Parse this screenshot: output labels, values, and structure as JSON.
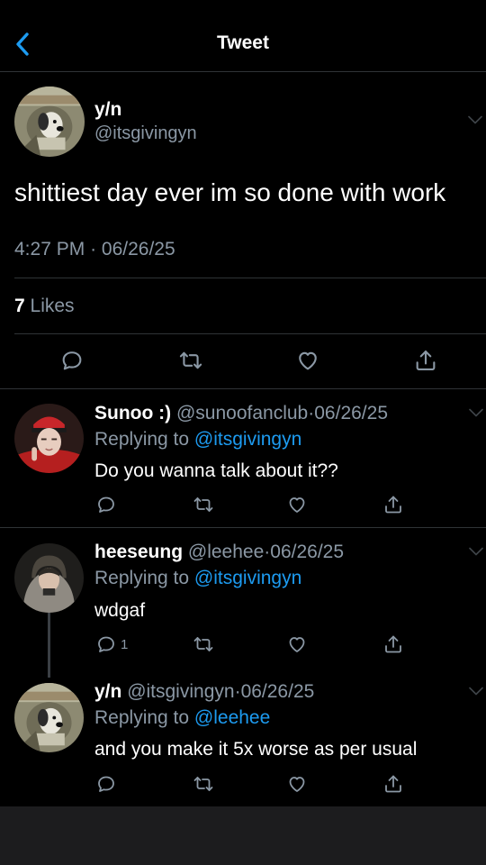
{
  "header": {
    "title": "Tweet"
  },
  "tweet": {
    "name": "y/n",
    "handle": "@itsgivingyn",
    "text": "shittiest day ever im so done with work",
    "time": "4:27 PM",
    "date": "06/26/25",
    "likes_count": "7",
    "likes_label": "Likes"
  },
  "replies": [
    {
      "name": "Sunoo :)",
      "handle": "@sunoofanclub",
      "date": "06/26/25",
      "replying_label": "Replying to",
      "replying_to": "@itsgivingyn",
      "text": "Do you wanna talk about it??",
      "reply_count": ""
    },
    {
      "name": "heeseung",
      "handle": "@leehee",
      "date": "06/26/25",
      "replying_label": "Replying to",
      "replying_to": "@itsgivingyn",
      "text": "wdgaf",
      "reply_count": "1"
    },
    {
      "name": "y/n",
      "handle": "@itsgivingyn",
      "date": "06/26/25",
      "replying_label": "Replying to",
      "replying_to": "@leehee",
      "text": "and you make it 5x worse as per usual",
      "reply_count": ""
    }
  ],
  "separator": "·",
  "icons": [
    "back-chevron-icon",
    "more-chevron-icon",
    "reply-icon",
    "retweet-icon",
    "like-icon",
    "share-icon"
  ],
  "colors": {
    "background": "#000000",
    "accent": "#1d9bf0",
    "secondary_text": "#8b98a5",
    "divider": "#2f3336"
  }
}
